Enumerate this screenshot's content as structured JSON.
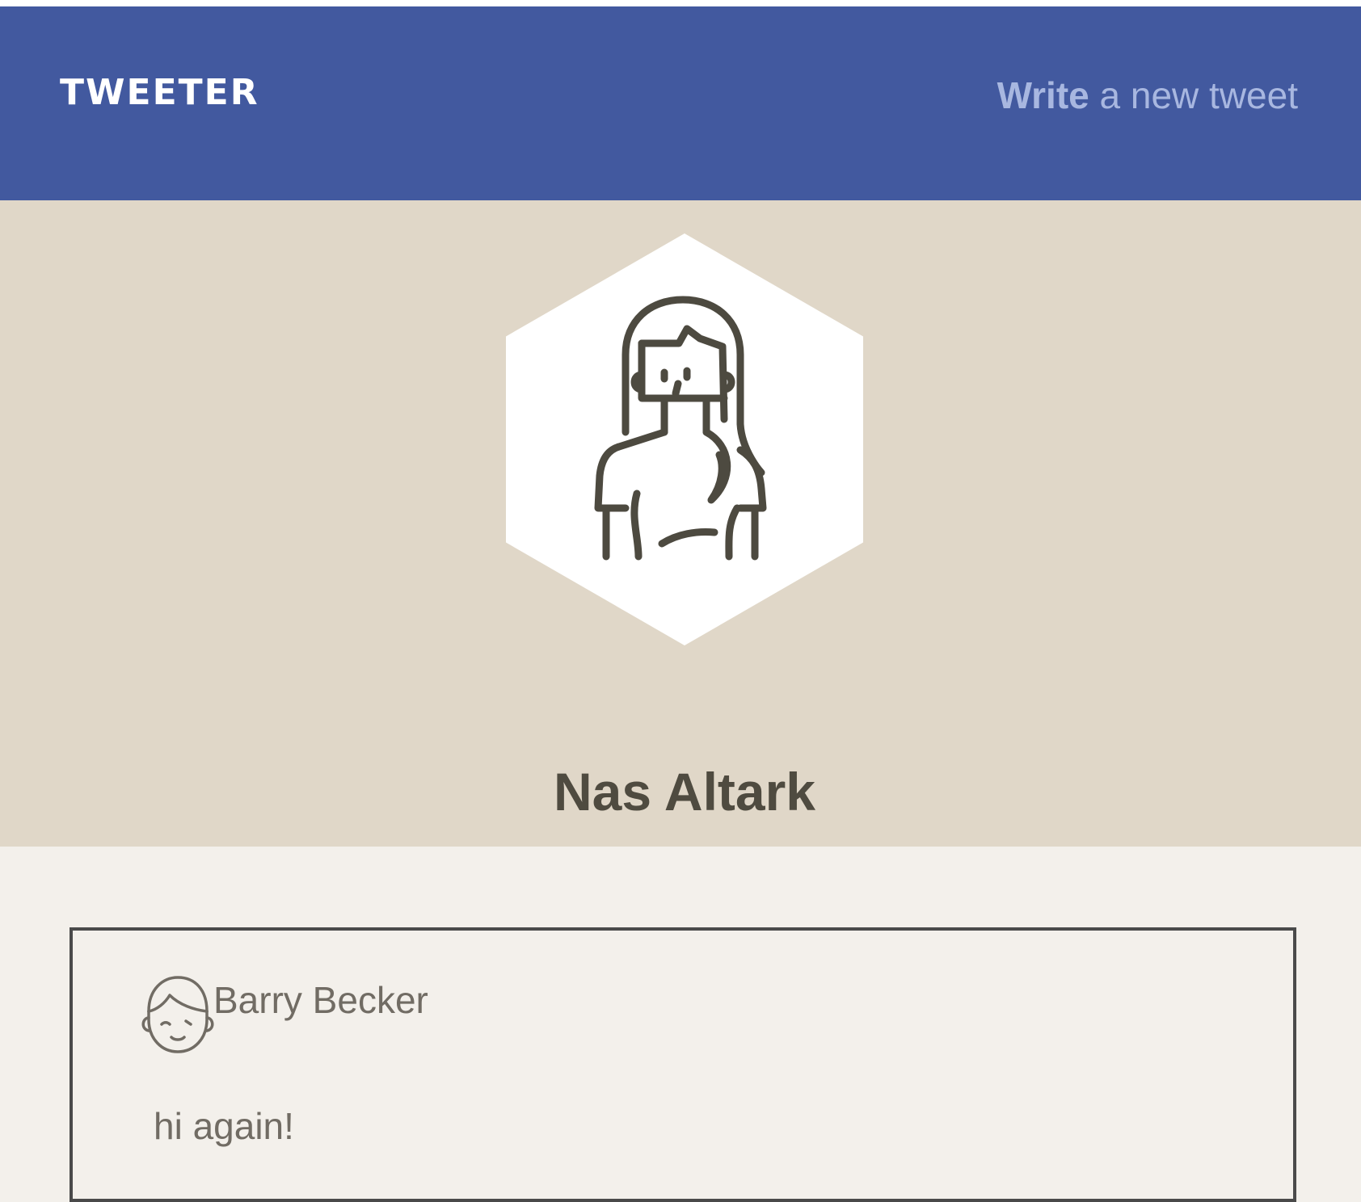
{
  "nav": {
    "brand": "TWEETER",
    "compose_strong": "Write",
    "compose_rest": " a new tweet"
  },
  "profile": {
    "name": "Nas Altark",
    "avatar_icon": "woman-avatar-icon"
  },
  "tweets": [
    {
      "author": "Barry Becker",
      "avatar_icon": "man-avatar-icon",
      "text": "hi again!"
    }
  ],
  "colors": {
    "nav_background": "#42599f",
    "nav_link": "#a8b7e0",
    "profile_background": "#e0d7c8",
    "page_background": "#f3f0eb",
    "name_text": "#4f4b40",
    "tweet_text": "#716c64",
    "card_border": "#4a4a4a"
  }
}
